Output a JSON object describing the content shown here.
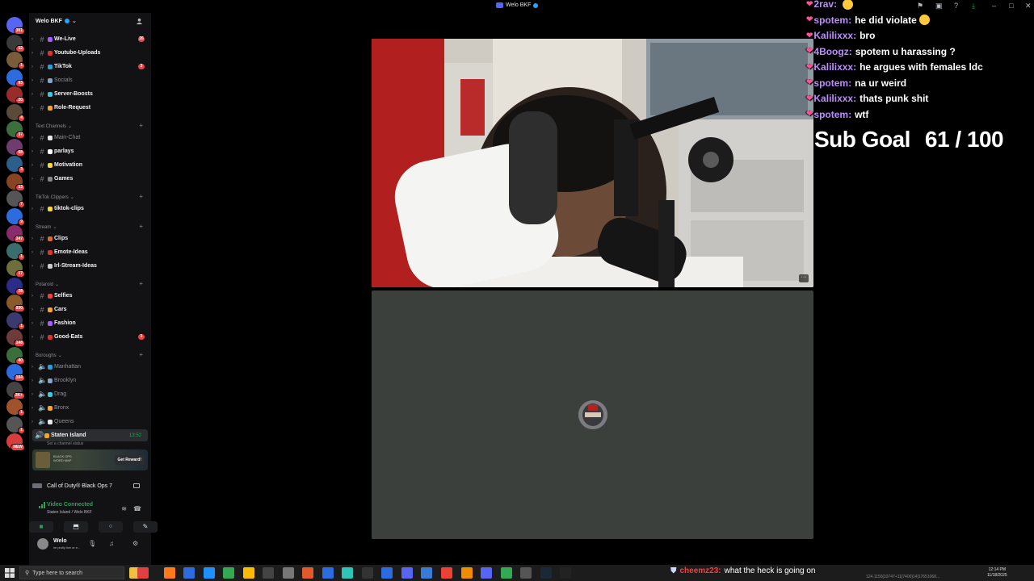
{
  "window": {
    "title": "Welo BKF"
  },
  "colors": {
    "accent": "#5865f2",
    "online": "#23a559",
    "danger": "#f23f43",
    "chat_name": "#bd8cff",
    "chat_heart": "#ff4f9b"
  },
  "server": {
    "name": "Welo BKF",
    "rail_badges": [
      "301",
      "12",
      "1",
      "93",
      "20",
      "4",
      "37",
      "68",
      "3",
      "13",
      "7",
      "9",
      "347",
      "1",
      "17",
      "28",
      "930",
      "1",
      "148",
      "40",
      "104",
      "2K+",
      "1",
      "1",
      "NEW"
    ]
  },
  "sidebar": {
    "top_channels": [
      {
        "label": "We-Live",
        "unread": "26",
        "bold": true
      },
      {
        "label": "Youtube-Uploads",
        "unread": "",
        "bold": true
      },
      {
        "label": "TikTok",
        "unread": "3",
        "bold": true
      },
      {
        "label": "Socials",
        "unread": "",
        "bold": false
      },
      {
        "label": "Server-Boosts",
        "unread": "",
        "bold": true
      },
      {
        "label": "Role-Request",
        "unread": "",
        "bold": true
      }
    ],
    "cat_text": "Text Channels",
    "text_channels": [
      {
        "label": "Main-Chat",
        "bold": false
      },
      {
        "label": "parlays",
        "bold": true
      },
      {
        "label": "Motivation",
        "bold": true
      },
      {
        "label": "Games",
        "bold": true
      }
    ],
    "cat_tiktok": "TikTok Clippers",
    "tiktok_channels": [
      {
        "label": "tiktok-clips",
        "bold": true
      }
    ],
    "cat_stream": "Stream",
    "stream_channels": [
      {
        "label": "Clips",
        "bold": true
      },
      {
        "label": "Emote-Ideas",
        "bold": true
      },
      {
        "label": "Irl-Stream-Ideas",
        "bold": true
      }
    ],
    "cat_polaroid": "Polaroid",
    "polaroid_channels": [
      {
        "label": "Selfies",
        "unread": "",
        "bold": true
      },
      {
        "label": "Cars",
        "unread": "",
        "bold": true
      },
      {
        "label": "Fashion",
        "unread": "",
        "bold": true
      },
      {
        "label": "Good-Eats",
        "unread": "1",
        "bold": true
      }
    ],
    "cat_boroughs": "Boroughs",
    "voice_channels": [
      {
        "label": "Manhattan"
      },
      {
        "label": "Brooklyn"
      },
      {
        "label": "Drag"
      },
      {
        "label": "Bronx"
      },
      {
        "label": "Queens"
      }
    ],
    "active_voice": {
      "label": "Staten Island",
      "time": "13:52",
      "status": "Set a channel status"
    },
    "promo": {
      "line1": "BLACK OPS",
      "line2": "WORD MAP",
      "button": "Get Reward!"
    },
    "activity": {
      "game": "Call of Duty® Black Ops 7"
    },
    "voice_connection": {
      "status": "Video Connected",
      "location": "Staten Island / Welo BKF"
    },
    "user": {
      "name": "Welo",
      "status": "im prolly live or e..."
    }
  },
  "chat": [
    {
      "user": "2rav:",
      "message": "",
      "emoji": true
    },
    {
      "user": "spotem:",
      "message": "he did violate",
      "emoji": true
    },
    {
      "user": "Kalilixxx:",
      "message": "bro",
      "emoji": false
    },
    {
      "user": "4Boogz:",
      "message": "spotem u harassing ?",
      "emoji": false
    },
    {
      "user": "Kalilixxx:",
      "message": "he argues with females ldc",
      "emoji": false
    },
    {
      "user": "spotem:",
      "message": "na ur weird",
      "emoji": false
    },
    {
      "user": "Kalilixxx:",
      "message": "thats punk shit",
      "emoji": false
    },
    {
      "user": "spotem:",
      "message": "wtf",
      "emoji": false
    }
  ],
  "sub_goal": {
    "label": "Sub Goal",
    "current": 61,
    "target": 100,
    "text": "61 / 100"
  },
  "taskbar": {
    "search_placeholder": "Type here to search",
    "chat_user": "cheemz23:",
    "chat_message": "what the heck is going on",
    "clock_time": "12:14 PM",
    "clock_date": "11/18/2025",
    "overlay_noise": "124.1156[10747+11[7400]14]17651068..."
  }
}
